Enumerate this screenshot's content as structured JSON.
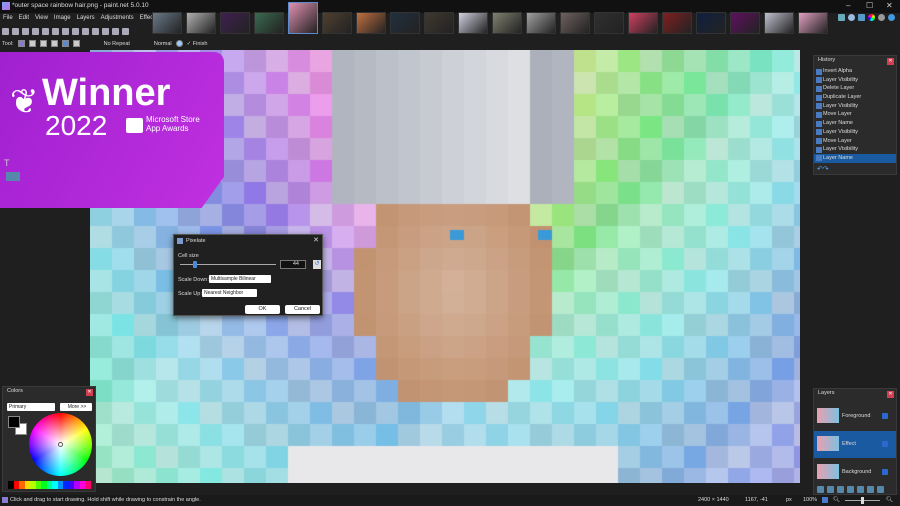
{
  "window": {
    "title": "*outer space rainbow hair.png - paint.net 5.0.10",
    "minimize": "–",
    "maximize": "☐",
    "close": "✕"
  },
  "menu": [
    "File",
    "Edit",
    "View",
    "Image",
    "Layers",
    "Adjustments",
    "Effects"
  ],
  "tab_thumbnails": [
    "#6a7a8a",
    "#b0b0b0",
    "#402050",
    "#3a6a50",
    "#e090b0",
    "#504030",
    "#c07040",
    "#203040",
    "#403830",
    "#d0d0e0",
    "#808070",
    "#a0a0a0",
    "#706060",
    "#303030",
    "#d04060",
    "#802020",
    "#102040",
    "#601060",
    "#c0c0d0",
    "#e0a0c0"
  ],
  "toolbar": {
    "tool_label": "Tool:",
    "repeat": "No Repeat",
    "blend": "Normal",
    "finish": "Finish"
  },
  "badge": {
    "title": "Winner",
    "year": "2022",
    "line1": "Microsoft Store",
    "line2": "App Awards"
  },
  "history": {
    "title": "History",
    "items": [
      "Invert Alpha",
      "Layer Visibility",
      "Delete Layer",
      "Duplicate Layer",
      "Layer Visibility",
      "Move Layer",
      "Layer Name",
      "Layer Visibility",
      "Move Layer",
      "Layer Visibility",
      "Layer Name"
    ],
    "selected": 10
  },
  "dialog": {
    "title": "Pixelate",
    "cell_size_label": "Cell size",
    "cell_size": "44",
    "slider_fraction": 0.14,
    "scale_down_label": "Scale Down:",
    "scale_down": "Multisample Bilinear",
    "scale_up_label": "Scale Up:",
    "scale_up": "Nearest Neighbor",
    "ok": "OK",
    "cancel": "Cancel"
  },
  "colors": {
    "title": "Colors",
    "mode": "Primary",
    "more": "More >>",
    "primary": "#000000",
    "secondary": "#ffffff",
    "palette": [
      "#000000",
      "#ff0000",
      "#ff6a00",
      "#ffd800",
      "#b6ff00",
      "#4cff00",
      "#00ff21",
      "#00ff90",
      "#00ffff",
      "#0094ff",
      "#0026ff",
      "#4800ff",
      "#b200ff",
      "#ff00dc",
      "#ff006e"
    ]
  },
  "layers": {
    "title": "Layers",
    "items": [
      {
        "name": "Foreground",
        "visible": true
      },
      {
        "name": "Effect",
        "visible": true
      },
      {
        "name": "Background",
        "visible": true
      }
    ],
    "selected": 1
  },
  "status": {
    "hint": "Click and drag to start drawing. Hold shift while drawing to constrain the angle.",
    "image_size": "2400 × 1440",
    "cursor": "1167, -41",
    "units": "px",
    "zoom": "100%"
  }
}
